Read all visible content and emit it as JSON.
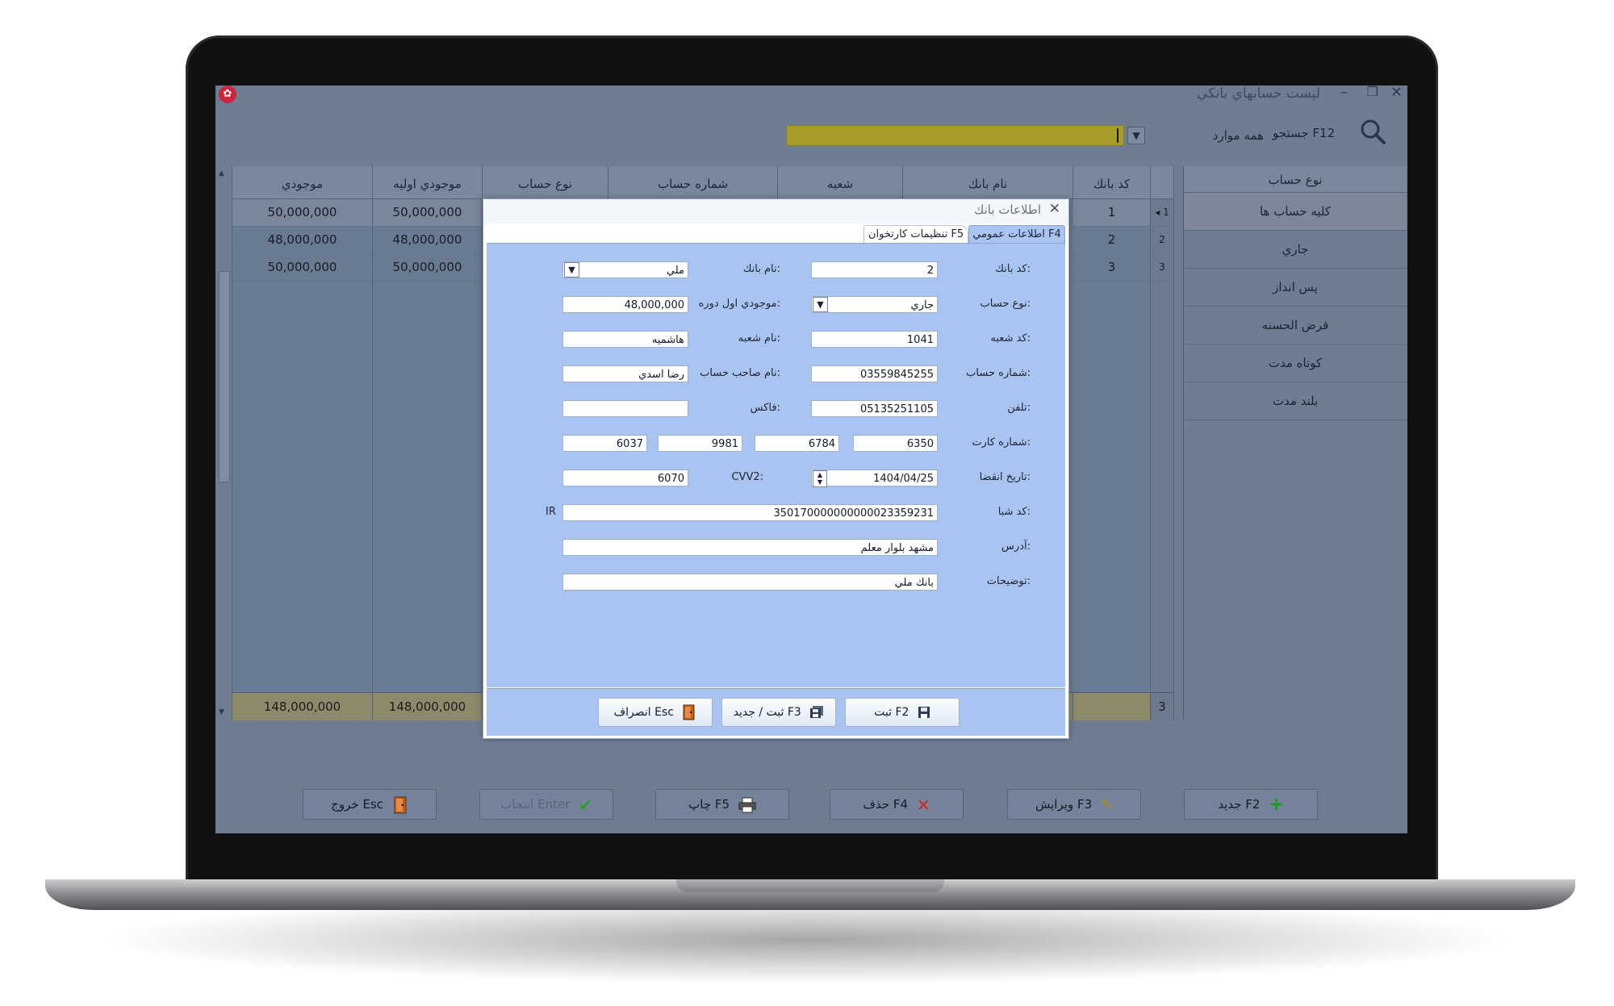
{
  "window": {
    "title": "ليست حسابهاي بانكي",
    "min": "–",
    "restore": "❐",
    "close": "✕",
    "logo": "✿"
  },
  "search": {
    "label": "جستجو F12",
    "filter_value": "همه موارد",
    "query": ""
  },
  "grid": {
    "headers": {
      "row_marker": "",
      "bank_code": "كد بانك",
      "bank_name": "نام بانك",
      "branch": "شعبه",
      "account_no": "شماره حساب",
      "account_type": "نوع حساب",
      "initial_balance": "موجودي اوليه",
      "balance": "موجودي"
    },
    "rows": [
      {
        "marker": "◂ 1",
        "bank_code": "1",
        "initial_balance": "50,000,000",
        "balance": "50,000,000"
      },
      {
        "marker": "2",
        "bank_code": "2",
        "initial_balance": "48,000,000",
        "balance": "48,000,000"
      },
      {
        "marker": "3",
        "bank_code": "3",
        "initial_balance": "50,000,000",
        "balance": "50,000,000"
      }
    ],
    "footer": {
      "count": "3",
      "initial_total": "148,000,000",
      "balance_total": "148,000,000"
    }
  },
  "sidebar": {
    "title": "نوع حساب",
    "items": [
      {
        "label": "كليه حساب ها"
      },
      {
        "label": "جاري"
      },
      {
        "label": "پس انداز"
      },
      {
        "label": "قرض الحسنه"
      },
      {
        "label": "كوتاه مدت"
      },
      {
        "label": "بلند مدت"
      }
    ]
  },
  "toolbar": {
    "new": "جديد F2",
    "edit": "ويرايش F3",
    "delete": "حذف F4",
    "print": "چاپ F5",
    "select": "انتخاب Enter",
    "exit": "خروج Esc"
  },
  "dialog": {
    "title": "اطلاعات بانك",
    "close": "✕",
    "tabs": {
      "general": "اطلاعات عمومي F4",
      "card_reader": "تنظيمات كارتخوان F5"
    },
    "labels": {
      "bank_code": "كد بانك:",
      "bank_name": "نام بانك:",
      "account_type": "نوع حساب:",
      "initial_balance": "موجودي اول دوره:",
      "branch_code": "كد شعبه:",
      "branch_name": "نام شعبه:",
      "account_no": "شماره حساب:",
      "holder": "نام صاحب حساب:",
      "phone": "تلفن:",
      "fax": "فاكس:",
      "card_no": "شماره كارت:",
      "expiry": "تاريخ انقضا:",
      "cvv2": "CVV2:",
      "sheba": "كد شبا:",
      "sheba_prefix": "IR",
      "address": "آدرس:",
      "notes": "توضيحات:"
    },
    "values": {
      "bank_code": "2",
      "bank_name": "ملي",
      "account_type": "جاري",
      "initial_balance": "48,000,000",
      "branch_code": "1041",
      "branch_name": "هاشميه",
      "account_no": "03559845255",
      "holder": "رضا اسدي",
      "phone": "05135251105",
      "fax": "",
      "card_1": "6350",
      "card_2": "6784",
      "card_3": "9981",
      "card_4": "6037",
      "expiry": "1404/04/25",
      "cvv2": "6070",
      "sheba": "350170000000000023359231",
      "address": "مشهد بلوار معلم",
      "notes": "بانك ملي"
    },
    "buttons": {
      "save": "ثبت F2",
      "save_new": "ثبت / جديد F3",
      "cancel": "انصراف Esc"
    }
  },
  "colors": {
    "screen_bg": "#6f7d92",
    "dialog_bg": "#aac4f1",
    "search_bar": "#a79b2a",
    "footer_row": "#8c8a6a"
  }
}
